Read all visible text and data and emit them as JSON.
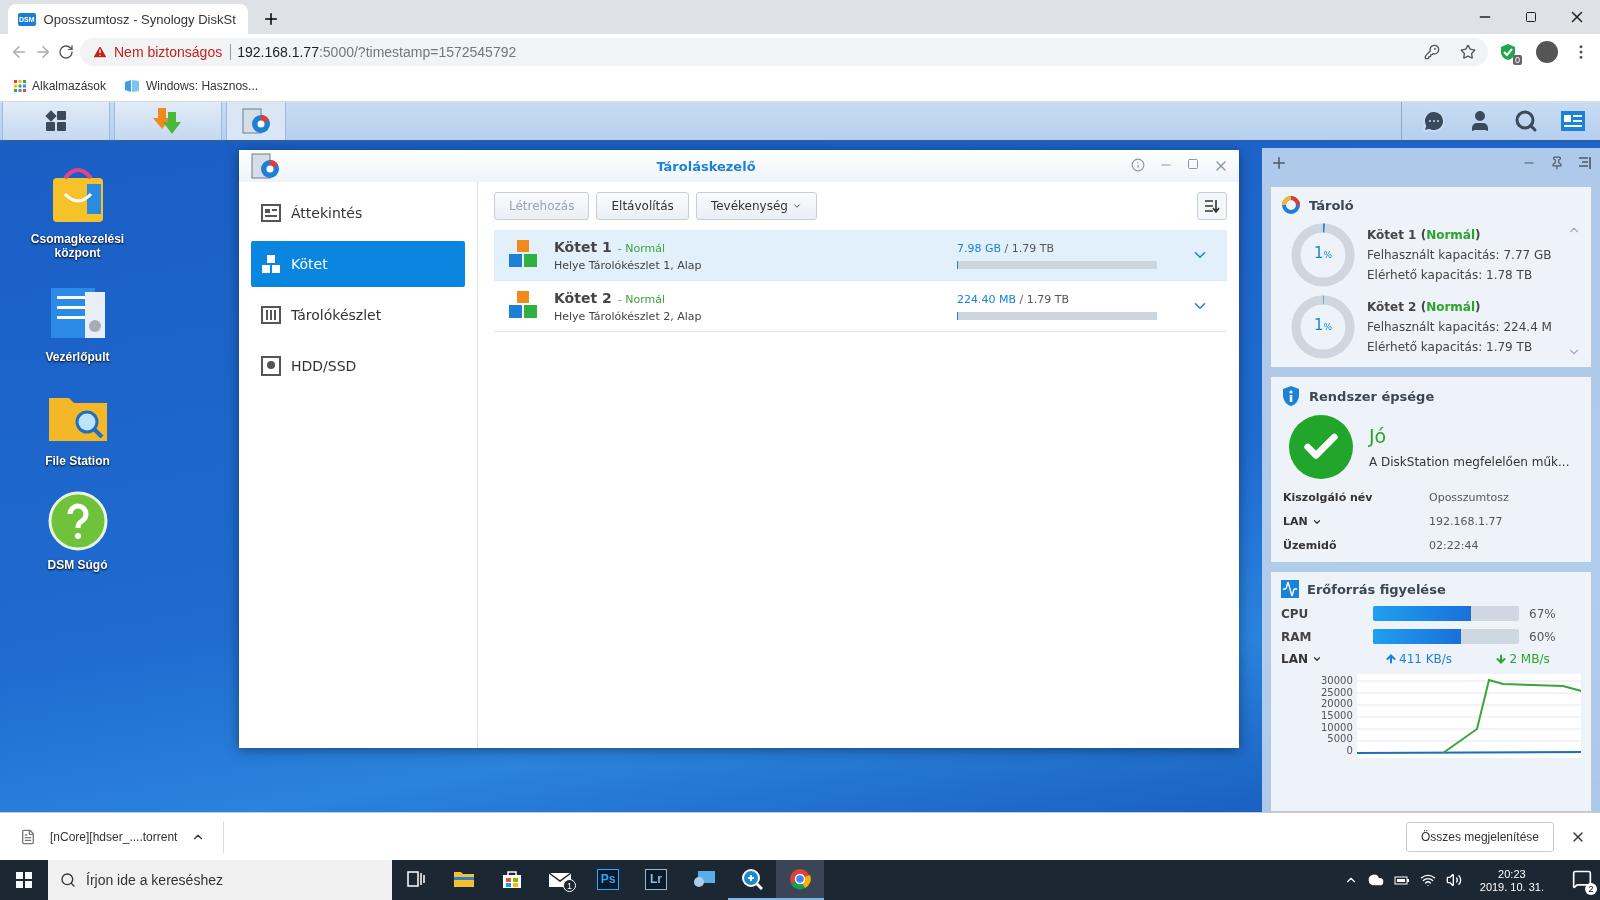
{
  "browser": {
    "tab": {
      "title": "Oposszumtosz - Synology DiskSt",
      "favicon": "DSM"
    },
    "address": {
      "security": "Nem biztonságos",
      "host": "192.168.1.77",
      "path": ":5000/?timestamp=1572545792",
      "extension_badge": "0"
    },
    "bookmarks": [
      {
        "kind": "apps",
        "label": "Alkalmazások"
      },
      {
        "kind": "page",
        "label": "Windows: Hasznos..."
      }
    ]
  },
  "dsm_taskbar": {
    "apps": [
      {
        "kind": "main-menu",
        "selected": false
      },
      {
        "kind": "download",
        "selected": false
      },
      {
        "kind": "storage",
        "selected": true
      }
    ]
  },
  "desktop_icons": [
    {
      "kind": "package",
      "label": "Csomagkezelési központ"
    },
    {
      "kind": "control",
      "label": "Vezérlőpult"
    },
    {
      "kind": "folder",
      "label": "File Station"
    },
    {
      "kind": "help",
      "label": "DSM Súgó"
    }
  ],
  "window": {
    "title": "Tároláskezelő",
    "sidebar": [
      {
        "kind": "overview",
        "label": "Áttekintés",
        "selected": false
      },
      {
        "kind": "volume",
        "label": "Kötet",
        "selected": true
      },
      {
        "kind": "pool",
        "label": "Tárolókészlet",
        "selected": false
      },
      {
        "kind": "disk",
        "label": "HDD/SSD",
        "selected": false
      }
    ],
    "toolbar": [
      {
        "label": "Létrehozás",
        "disabled": true,
        "menu": false
      },
      {
        "label": "Eltávolítás",
        "disabled": false,
        "menu": false
      },
      {
        "label": "Tevékenység",
        "disabled": false,
        "menu": true
      }
    ],
    "volumes": [
      {
        "name": "Kötet 1",
        "status": "- Normál",
        "location": "Helye Tárolókészlet 1, Alap",
        "used": "7.98 GB",
        "total": " / 1.79 TB",
        "level": 0.005,
        "selected": true
      },
      {
        "name": "Kötet 2",
        "status": "- Normál",
        "location": "Helye Tárolókészlet 2, Alap",
        "used": "224.40 MB",
        "total": " / 1.79 TB",
        "level": 0.002,
        "selected": false
      }
    ]
  },
  "widgets": {
    "storage": {
      "title": "Tároló",
      "volumes": [
        {
          "percent": "1",
          "unit": "%",
          "level": 0.01,
          "name": "Kötet 1",
          "open": "(",
          "status": "Normál",
          "close": ")",
          "used": "Felhasznált kapacitás: 7.77 GB",
          "available": "Elérhető kapacitás: 1.78 TB"
        },
        {
          "percent": "1",
          "unit": "%",
          "level": 0.001,
          "name": "Kötet 2",
          "open": "(",
          "status": "Normál",
          "close": ")",
          "used": "Felhasznált kapacitás: 224.4 M",
          "available": "Elérhető kapacitás: 1.79 TB"
        }
      ]
    },
    "health": {
      "title": "Rendszer épsége",
      "status": "Jó",
      "message": "A DiskStation megfelelően műk...",
      "rows": [
        {
          "label": "Kiszolgáló név",
          "value": "Oposszumtosz",
          "menu": false
        },
        {
          "label": "LAN",
          "value": "192.168.1.77",
          "menu": true
        },
        {
          "label": "Üzemidő",
          "value": "02:22:44",
          "menu": false
        }
      ]
    },
    "resources": {
      "title": "Erőforrás figyelése",
      "meters": [
        {
          "label": "CPU",
          "level": 0.67,
          "reading": "67%"
        },
        {
          "label": "RAM",
          "level": 0.6,
          "reading": "60%"
        }
      ],
      "lan": {
        "label": "LAN",
        "up": "411 KB/s",
        "down": "2 MB/s"
      },
      "graph": {
        "axis_labels": [
          "30000",
          "25000",
          "20000",
          "15000",
          "10000",
          "5000",
          "0"
        ]
      }
    }
  },
  "download_bar": {
    "file": "[nCore][hdser_....torrent",
    "show_all": "Összes megjelenítése"
  },
  "taskbar": {
    "search_placeholder": "Írjon ide a kereséshez",
    "apps": [
      {
        "kind": "taskview",
        "selected": false,
        "running": false
      },
      {
        "kind": "explorer",
        "selected": false,
        "running": false
      },
      {
        "kind": "store",
        "selected": false,
        "running": false
      },
      {
        "kind": "mail",
        "badge": "1",
        "selected": false,
        "running": false
      },
      {
        "kind": "ps",
        "label": "Ps",
        "selected": false,
        "running": false
      },
      {
        "kind": "lr",
        "label": "Lr",
        "selected": false,
        "running": false
      },
      {
        "kind": "remote",
        "selected": false,
        "running": false
      },
      {
        "kind": "magnifier",
        "selected": false,
        "running": true
      },
      {
        "kind": "chrome",
        "selected": true,
        "running": true
      }
    ],
    "time": "20:23",
    "date": "2019. 10. 31.",
    "notifications": "2"
  }
}
